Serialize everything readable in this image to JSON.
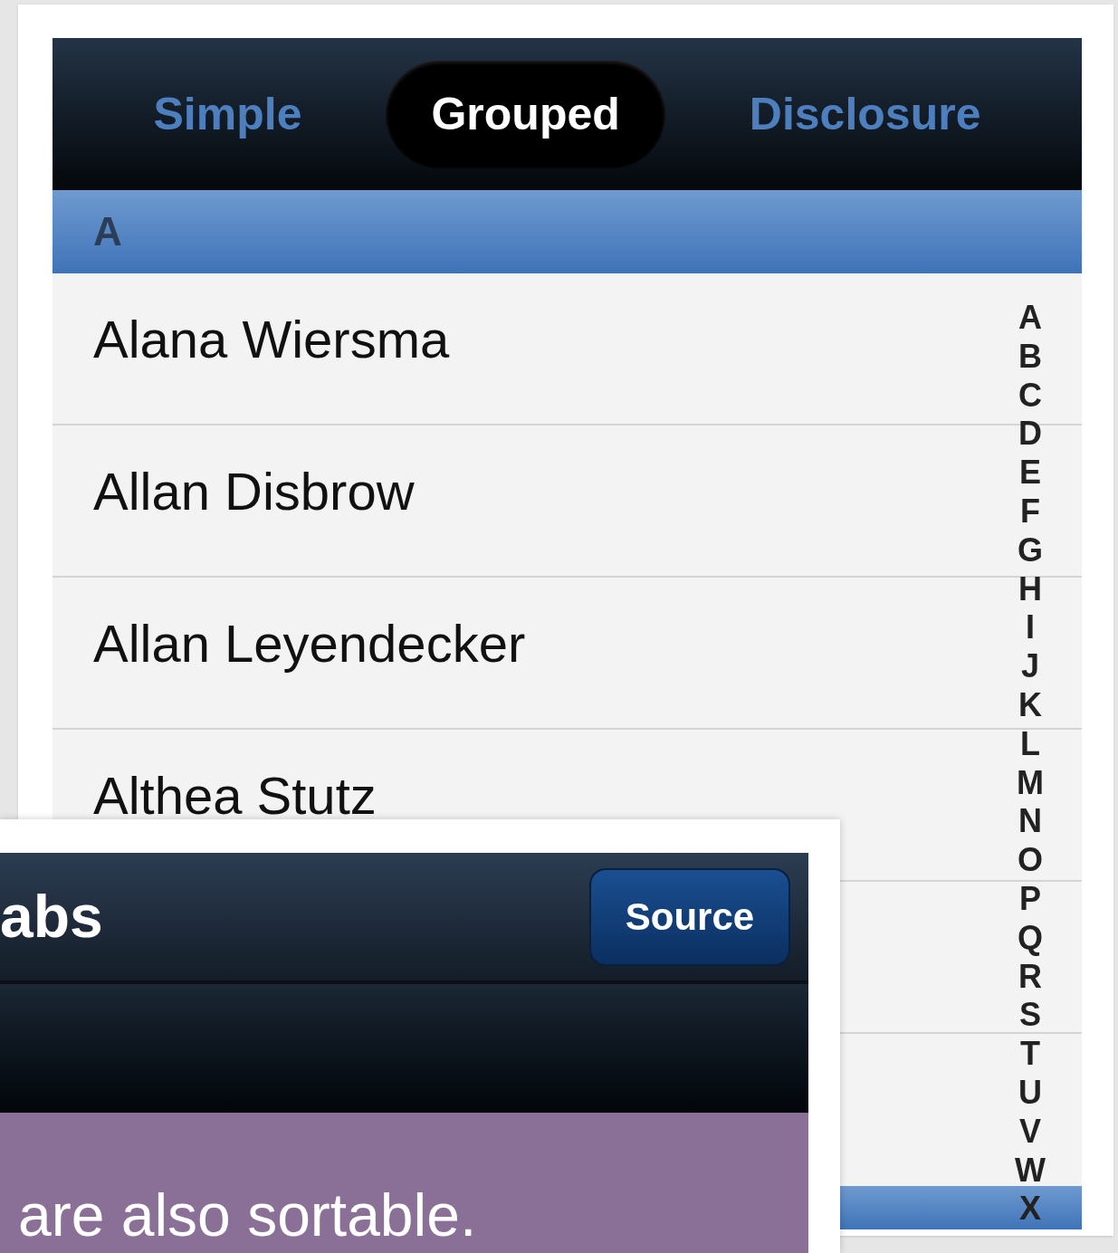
{
  "back_screen": {
    "tabs": [
      {
        "label": "Simple",
        "selected": false
      },
      {
        "label": "Grouped",
        "selected": true
      },
      {
        "label": "Disclosure",
        "selected": false
      }
    ],
    "section_header": "A",
    "rows": [
      "Alana Wiersma",
      "Allan Disbrow",
      "Allan Leyendecker",
      "Althea Stutz"
    ],
    "index": [
      "A",
      "B",
      "C",
      "D",
      "E",
      "F",
      "G",
      "H",
      "I",
      "J",
      "K",
      "L",
      "M",
      "N",
      "O",
      "P",
      "Q",
      "R",
      "S",
      "T",
      "U",
      "V",
      "W",
      "X"
    ]
  },
  "front_screen": {
    "title": "abs",
    "button": "Source",
    "message": "are also sortable."
  }
}
